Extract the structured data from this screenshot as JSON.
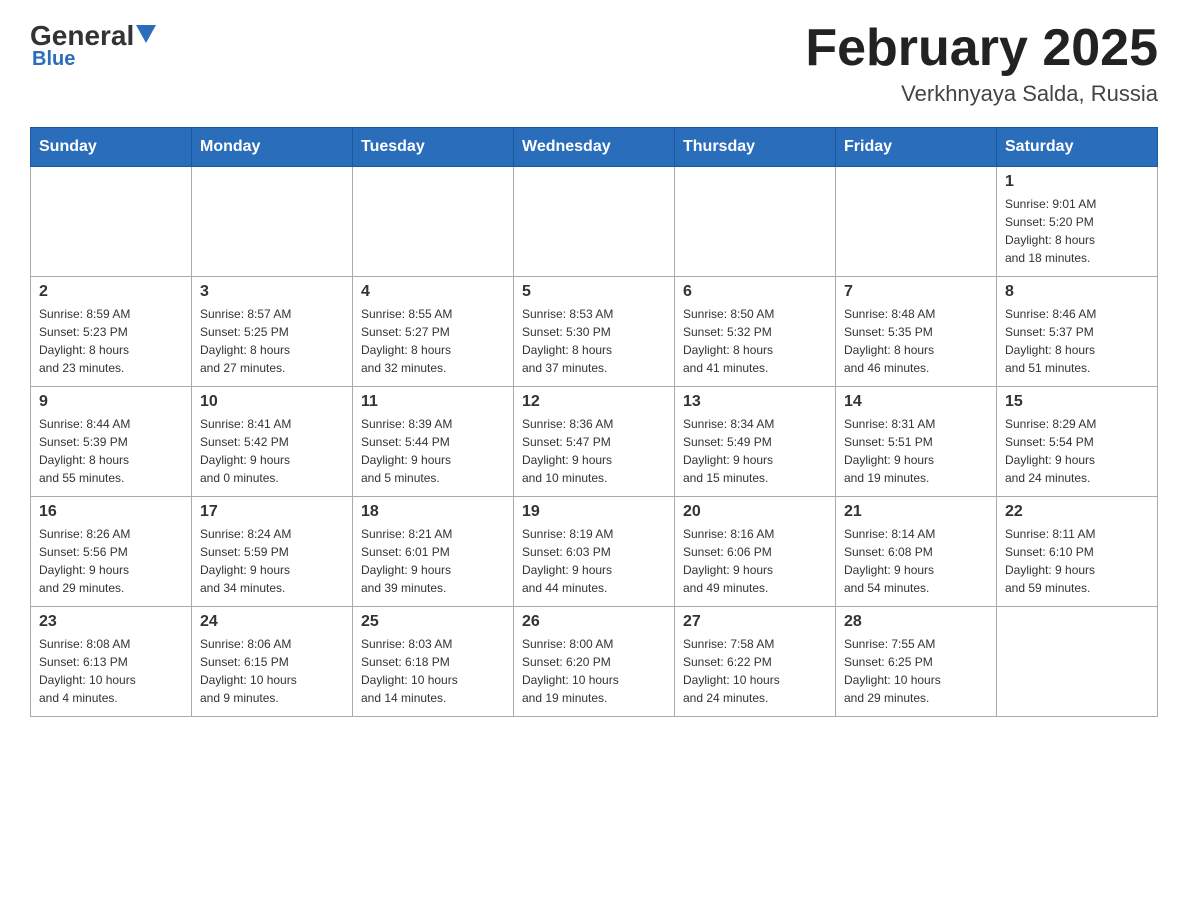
{
  "header": {
    "logo": {
      "general": "General",
      "arrow": "▼",
      "blue": "Blue"
    },
    "title": "February 2025",
    "location": "Verkhnyaya Salda, Russia"
  },
  "weekdays": [
    "Sunday",
    "Monday",
    "Tuesday",
    "Wednesday",
    "Thursday",
    "Friday",
    "Saturday"
  ],
  "weeks": [
    [
      {
        "day": "",
        "info": ""
      },
      {
        "day": "",
        "info": ""
      },
      {
        "day": "",
        "info": ""
      },
      {
        "day": "",
        "info": ""
      },
      {
        "day": "",
        "info": ""
      },
      {
        "day": "",
        "info": ""
      },
      {
        "day": "1",
        "info": "Sunrise: 9:01 AM\nSunset: 5:20 PM\nDaylight: 8 hours\nand 18 minutes."
      }
    ],
    [
      {
        "day": "2",
        "info": "Sunrise: 8:59 AM\nSunset: 5:23 PM\nDaylight: 8 hours\nand 23 minutes."
      },
      {
        "day": "3",
        "info": "Sunrise: 8:57 AM\nSunset: 5:25 PM\nDaylight: 8 hours\nand 27 minutes."
      },
      {
        "day": "4",
        "info": "Sunrise: 8:55 AM\nSunset: 5:27 PM\nDaylight: 8 hours\nand 32 minutes."
      },
      {
        "day": "5",
        "info": "Sunrise: 8:53 AM\nSunset: 5:30 PM\nDaylight: 8 hours\nand 37 minutes."
      },
      {
        "day": "6",
        "info": "Sunrise: 8:50 AM\nSunset: 5:32 PM\nDaylight: 8 hours\nand 41 minutes."
      },
      {
        "day": "7",
        "info": "Sunrise: 8:48 AM\nSunset: 5:35 PM\nDaylight: 8 hours\nand 46 minutes."
      },
      {
        "day": "8",
        "info": "Sunrise: 8:46 AM\nSunset: 5:37 PM\nDaylight: 8 hours\nand 51 minutes."
      }
    ],
    [
      {
        "day": "9",
        "info": "Sunrise: 8:44 AM\nSunset: 5:39 PM\nDaylight: 8 hours\nand 55 minutes."
      },
      {
        "day": "10",
        "info": "Sunrise: 8:41 AM\nSunset: 5:42 PM\nDaylight: 9 hours\nand 0 minutes."
      },
      {
        "day": "11",
        "info": "Sunrise: 8:39 AM\nSunset: 5:44 PM\nDaylight: 9 hours\nand 5 minutes."
      },
      {
        "day": "12",
        "info": "Sunrise: 8:36 AM\nSunset: 5:47 PM\nDaylight: 9 hours\nand 10 minutes."
      },
      {
        "day": "13",
        "info": "Sunrise: 8:34 AM\nSunset: 5:49 PM\nDaylight: 9 hours\nand 15 minutes."
      },
      {
        "day": "14",
        "info": "Sunrise: 8:31 AM\nSunset: 5:51 PM\nDaylight: 9 hours\nand 19 minutes."
      },
      {
        "day": "15",
        "info": "Sunrise: 8:29 AM\nSunset: 5:54 PM\nDaylight: 9 hours\nand 24 minutes."
      }
    ],
    [
      {
        "day": "16",
        "info": "Sunrise: 8:26 AM\nSunset: 5:56 PM\nDaylight: 9 hours\nand 29 minutes."
      },
      {
        "day": "17",
        "info": "Sunrise: 8:24 AM\nSunset: 5:59 PM\nDaylight: 9 hours\nand 34 minutes."
      },
      {
        "day": "18",
        "info": "Sunrise: 8:21 AM\nSunset: 6:01 PM\nDaylight: 9 hours\nand 39 minutes."
      },
      {
        "day": "19",
        "info": "Sunrise: 8:19 AM\nSunset: 6:03 PM\nDaylight: 9 hours\nand 44 minutes."
      },
      {
        "day": "20",
        "info": "Sunrise: 8:16 AM\nSunset: 6:06 PM\nDaylight: 9 hours\nand 49 minutes."
      },
      {
        "day": "21",
        "info": "Sunrise: 8:14 AM\nSunset: 6:08 PM\nDaylight: 9 hours\nand 54 minutes."
      },
      {
        "day": "22",
        "info": "Sunrise: 8:11 AM\nSunset: 6:10 PM\nDaylight: 9 hours\nand 59 minutes."
      }
    ],
    [
      {
        "day": "23",
        "info": "Sunrise: 8:08 AM\nSunset: 6:13 PM\nDaylight: 10 hours\nand 4 minutes."
      },
      {
        "day": "24",
        "info": "Sunrise: 8:06 AM\nSunset: 6:15 PM\nDaylight: 10 hours\nand 9 minutes."
      },
      {
        "day": "25",
        "info": "Sunrise: 8:03 AM\nSunset: 6:18 PM\nDaylight: 10 hours\nand 14 minutes."
      },
      {
        "day": "26",
        "info": "Sunrise: 8:00 AM\nSunset: 6:20 PM\nDaylight: 10 hours\nand 19 minutes."
      },
      {
        "day": "27",
        "info": "Sunrise: 7:58 AM\nSunset: 6:22 PM\nDaylight: 10 hours\nand 24 minutes."
      },
      {
        "day": "28",
        "info": "Sunrise: 7:55 AM\nSunset: 6:25 PM\nDaylight: 10 hours\nand 29 minutes."
      },
      {
        "day": "",
        "info": ""
      }
    ]
  ]
}
